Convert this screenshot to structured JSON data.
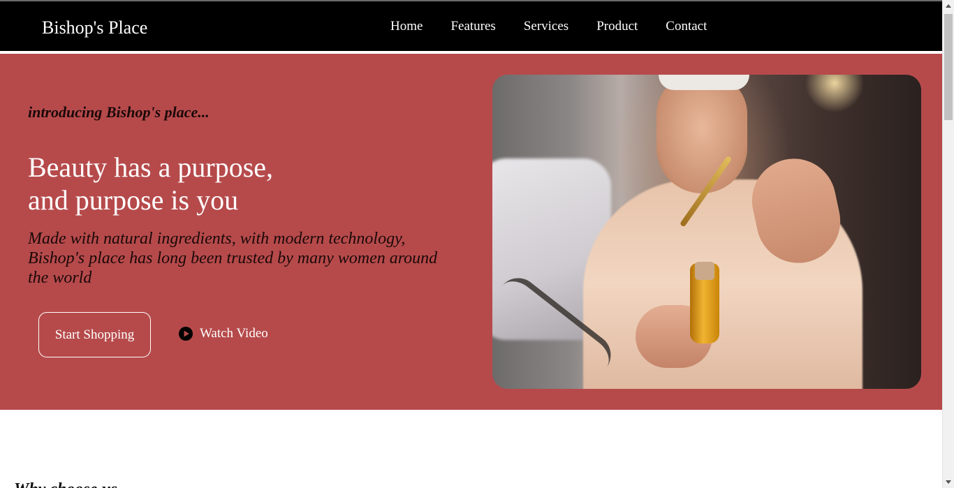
{
  "navbar": {
    "brand": "Bishop's Place",
    "links": [
      "Home",
      "Features",
      "Services",
      "Product",
      "Contact"
    ]
  },
  "hero": {
    "intro": "introducing Bishop's place...",
    "headline_line1": "Beauty has a purpose,",
    "headline_line2": "and purpose is you",
    "subtext": "Made with natural ingredients, with modern technology, Bishop's place has long been trusted by many women around the world",
    "primary_button": "Start Shopping",
    "secondary_button": "Watch Video",
    "image_alt_subject": "woman-with-serum-dropper",
    "background_color": "#b64a4b"
  },
  "sections": {
    "why_title": "Why choose us"
  },
  "icons": {
    "play": "play-circle-icon"
  }
}
